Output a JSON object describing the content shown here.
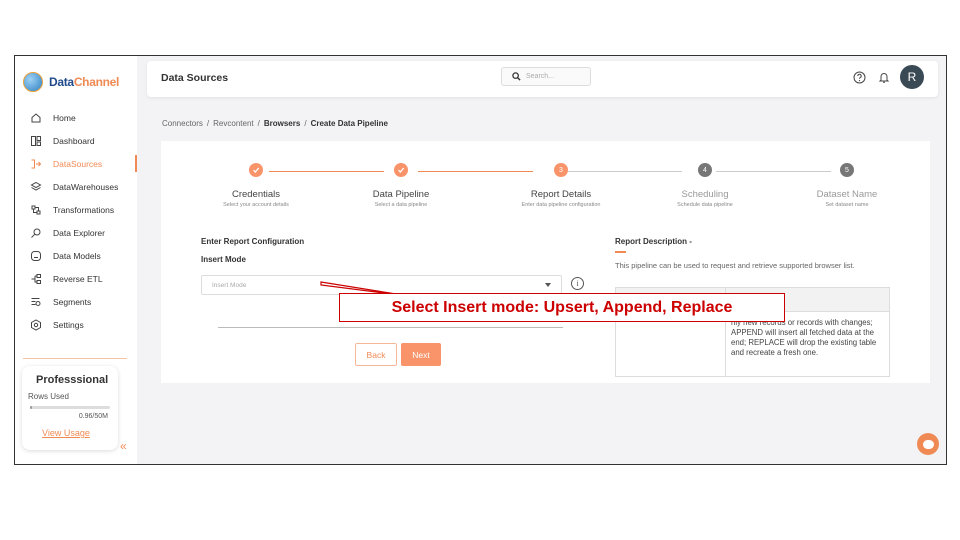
{
  "app": {
    "brand_part1": "Data",
    "brand_part2": "Channel"
  },
  "sidebar": {
    "items": [
      {
        "label": "Home",
        "icon": "home-icon",
        "active": false
      },
      {
        "label": "Dashboard",
        "icon": "dashboard-icon",
        "active": false
      },
      {
        "label": "DataSources",
        "icon": "datasources-icon",
        "active": true
      },
      {
        "label": "DataWarehouses",
        "icon": "datawarehouses-icon",
        "active": false
      },
      {
        "label": "Transformations",
        "icon": "transformations-icon",
        "active": false
      },
      {
        "label": "Data Explorer",
        "icon": "data-explorer-icon",
        "active": false
      },
      {
        "label": "Data Models",
        "icon": "data-models-icon",
        "active": false
      },
      {
        "label": "Reverse ETL",
        "icon": "reverse-etl-icon",
        "active": false
      },
      {
        "label": "Segments",
        "icon": "segments-icon",
        "active": false
      },
      {
        "label": "Settings",
        "icon": "settings-icon",
        "active": false
      }
    ],
    "plan": {
      "title": "Professsional",
      "rows_label": "Rows Used",
      "used_fraction": 0.0192,
      "used_text": "0.96/50M",
      "link": "View Usage"
    },
    "collapse_glyph": "«"
  },
  "header": {
    "title": "Data Sources",
    "search_placeholder": "Search...",
    "avatar_initial": "R"
  },
  "breadcrumb": [
    "Connectors",
    "Revcontent",
    "Browsers",
    "Create Data Pipeline"
  ],
  "stepper": [
    {
      "label": "Credentials",
      "sub": "Select your account details",
      "status": "done",
      "num": "1"
    },
    {
      "label": "Data Pipeline",
      "sub": "Select a data pipeline",
      "status": "done",
      "num": "2"
    },
    {
      "label": "Report Details",
      "sub": "Enter data pipeline configuration",
      "status": "current",
      "num": "3"
    },
    {
      "label": "Scheduling",
      "sub": "Schedule data pipeline",
      "status": "pending",
      "num": "4"
    },
    {
      "label": "Dataset Name",
      "sub": "Set dataset name",
      "status": "pending",
      "num": "5"
    }
  ],
  "form": {
    "section_title": "Enter Report Configuration",
    "insert_mode_label": "Insert Mode",
    "insert_mode_placeholder": "Insert Mode",
    "back_label": "Back",
    "next_label": "Next"
  },
  "description": {
    "title": "Report Description -",
    "text": "This pipeline can be used to request and retrieve supported browser list.",
    "table_cell": "nly new records or records with changes; APPEND will insert all fetched data at the end; REPLACE will drop the existing table and recreate a fresh one."
  },
  "callout": {
    "text": "Select Insert mode: Upsert, Append, Replace"
  },
  "colors": {
    "accent": "#f08a54",
    "callout": "#cc0000",
    "avatar": "#3a4a55"
  }
}
